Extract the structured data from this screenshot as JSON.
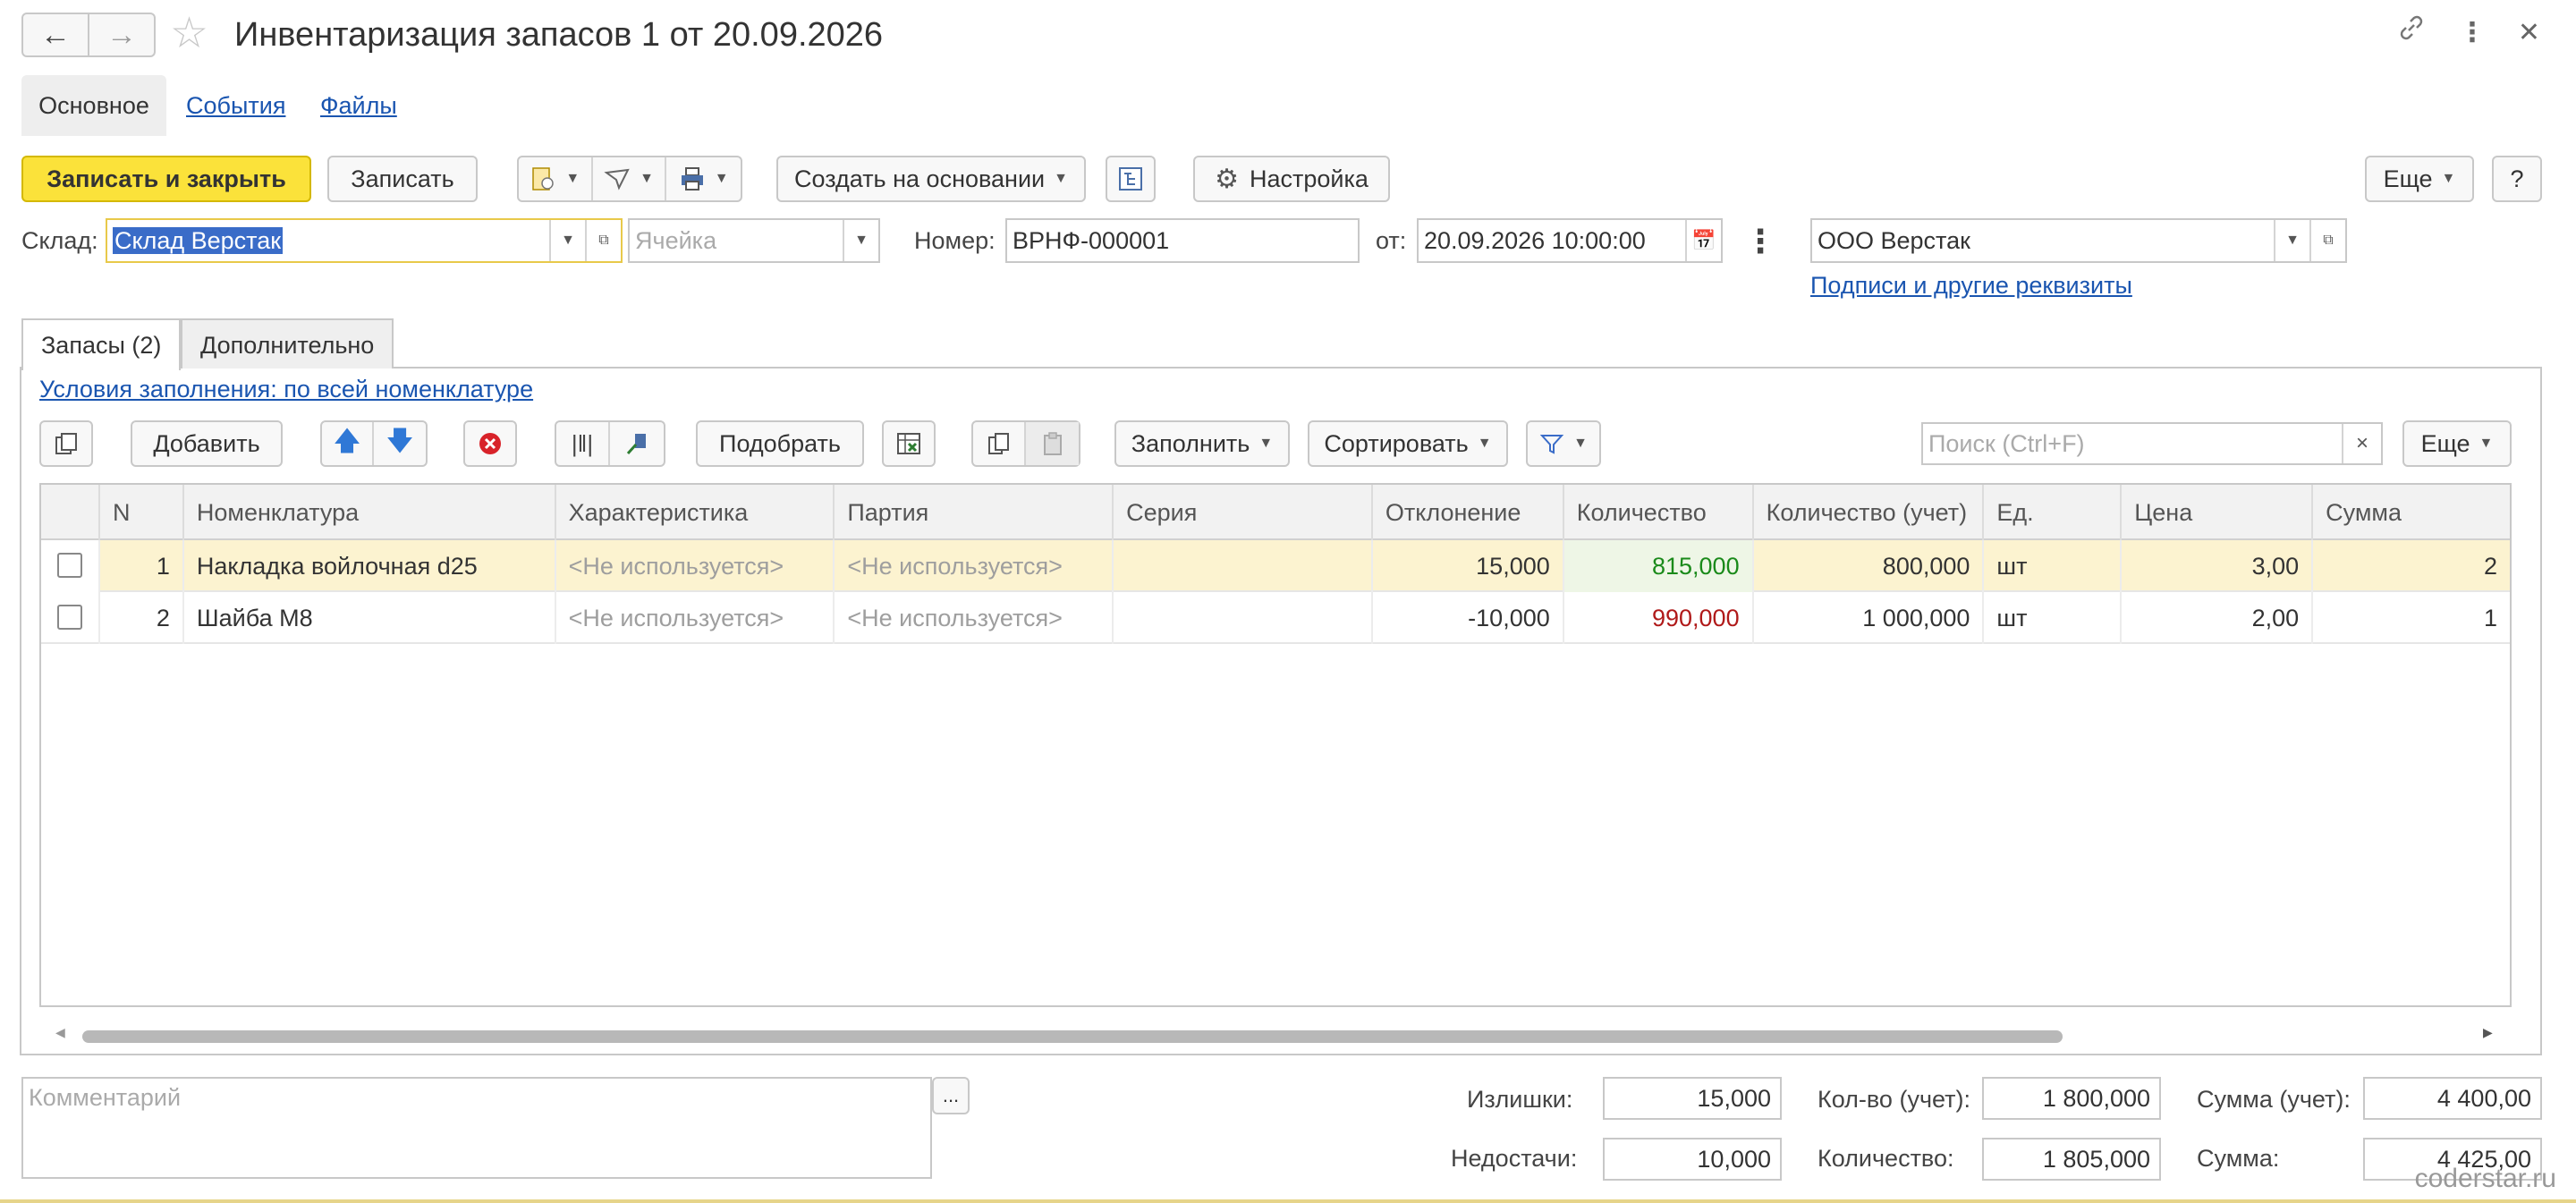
{
  "title": "Инвентаризация запасов 1 от 20.09.2026",
  "top_tabs": {
    "main": "Основное",
    "events": "События",
    "files": "Файлы"
  },
  "toolbar": {
    "save_close": "Записать и закрыть",
    "save": "Записать",
    "create_based": "Создать на основании",
    "settings": "Настройка",
    "more": "Еще",
    "help": "?"
  },
  "header": {
    "warehouse_label": "Склад:",
    "warehouse_value": "Склад Верстак",
    "cell_placeholder": "Ячейка",
    "number_label": "Номер:",
    "number_value": "ВРНФ-000001",
    "date_label": "от:",
    "date_value": "20.09.2026 10:00:00",
    "org_value": "ООО Верстак",
    "signatures_link": "Подписи и другие реквизиты"
  },
  "inner_tabs": {
    "stocks": "Запасы (2)",
    "additional": "Дополнительно"
  },
  "fill_conditions": "Условия заполнения: по всей номенклатуре",
  "table_toolbar": {
    "add": "Добавить",
    "pick": "Подобрать",
    "fill": "Заполнить",
    "sort": "Сортировать",
    "search_placeholder": "Поиск (Ctrl+F)",
    "clear": "×",
    "more": "Еще"
  },
  "columns": [
    "N",
    "Номенклатура",
    "Характеристика",
    "Партия",
    "Серия",
    "Отклонение",
    "Количество",
    "Количество (учет)",
    "Ед.",
    "Цена",
    "Сумма"
  ],
  "rows": [
    {
      "n": "1",
      "item": "Накладка войлочная d25",
      "char": "<Не используется>",
      "batch": "<Не используется>",
      "series": "",
      "dev": "15,000",
      "qty": "815,000",
      "qty_acc": "800,000",
      "unit": "шт",
      "price": "3,00",
      "sum": "2"
    },
    {
      "n": "2",
      "item": "Шайба М8",
      "char": "<Не используется>",
      "batch": "<Не используется>",
      "series": "",
      "dev": "-10,000",
      "qty": "990,000",
      "qty_acc": "1 000,000",
      "unit": "шт",
      "price": "2,00",
      "sum": "1"
    }
  ],
  "footer": {
    "comment_placeholder": "Комментарий",
    "ellipsis": "...",
    "surplus_label": "Излишки:",
    "surplus": "15,000",
    "shortage_label": "Недостачи:",
    "shortage": "10,000",
    "qty_acc_label": "Кол-во (учет):",
    "qty_acc": "1 800,000",
    "qty_label": "Количество:",
    "qty": "1 805,000",
    "sum_acc_label": "Сумма (учет):",
    "sum_acc": "4 400,00",
    "sum_label": "Сумма:",
    "sum": "4 425,00"
  },
  "watermark": "coderstar.ru",
  "colors": {
    "primary_button": "#fbe23a",
    "link": "#1a55b0",
    "selected_row": "#fcf3d0",
    "qty_over": "#1a8a1a",
    "qty_under": "#b01a1a"
  }
}
